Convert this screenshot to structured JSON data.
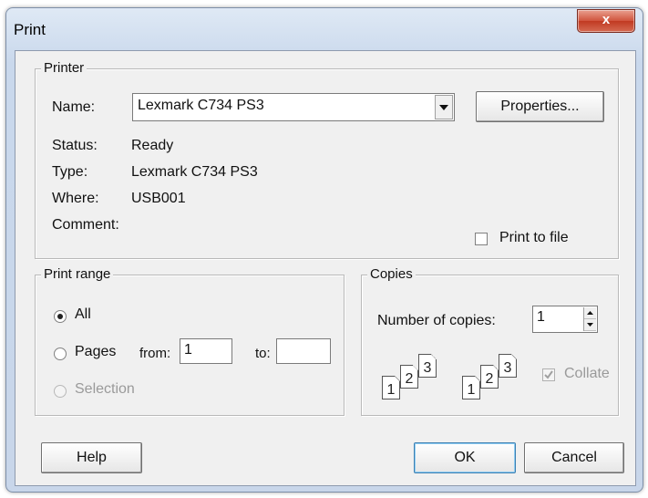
{
  "window": {
    "title": "Print",
    "close_glyph": "x"
  },
  "printer": {
    "legend": "Printer",
    "name_label": "Name:",
    "name_value": "Lexmark C734 PS3",
    "properties_label": "Properties...",
    "status_label": "Status:",
    "status_value": "Ready",
    "type_label": "Type:",
    "type_value": "Lexmark C734 PS3",
    "where_label": "Where:",
    "where_value": "USB001",
    "comment_label": "Comment:",
    "print_to_file_label": "Print to file",
    "print_to_file_checked": false
  },
  "print_range": {
    "legend": "Print range",
    "all_label": "All",
    "pages_label": "Pages",
    "from_label": "from:",
    "from_value": "1",
    "to_label": "to:",
    "to_value": "",
    "selection_label": "Selection",
    "selected": "All"
  },
  "copies": {
    "legend": "Copies",
    "number_label": "Number of copies:",
    "number_value": "1",
    "collate_label": "Collate",
    "collate_checked": true,
    "collate_pages_a": [
      "1",
      "2",
      "3"
    ],
    "collate_pages_b": [
      "1",
      "2",
      "3"
    ]
  },
  "footer": {
    "help_label": "Help",
    "ok_label": "OK",
    "cancel_label": "Cancel"
  },
  "icons": {
    "dropdown": "chevron-down-icon",
    "spin_up": "spin-up-icon",
    "spin_down": "spin-down-icon",
    "collate": "collate-pages-icon",
    "check": "checkmark-icon"
  }
}
